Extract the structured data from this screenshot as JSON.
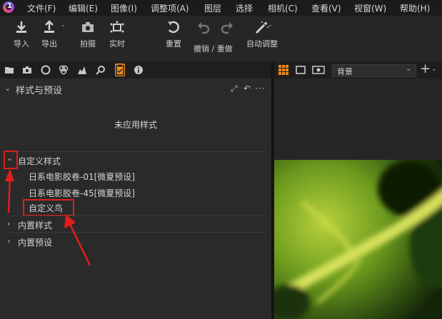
{
  "menu": [
    "文件(F)",
    "编辑(E)",
    "图像(I)",
    "调整项(A)",
    "图层",
    "选择",
    "相机(C)",
    "查看(V)",
    "视窗(W)",
    "帮助(H)"
  ],
  "toolbar": {
    "import": "导入",
    "export": "导出",
    "capture": "拍摄",
    "live": "实时",
    "reset": "重置",
    "undo_redo": "撤销 / 重做",
    "auto_adjust": "自动调整"
  },
  "panel": {
    "title": "样式与预设",
    "no_style": "未应用样式",
    "custom_styles": "自定义样式",
    "items": [
      "日系电影胶卷-01[微夏预设]",
      "日系电影胶卷-45[微夏预设]",
      "自定义鸟"
    ],
    "builtin_styles": "内置样式",
    "builtin_presets": "内置预设"
  },
  "viewer": {
    "background_select": "背景"
  },
  "colors": {
    "accent": "#f28c1e",
    "highlight": "#e01e1e"
  }
}
